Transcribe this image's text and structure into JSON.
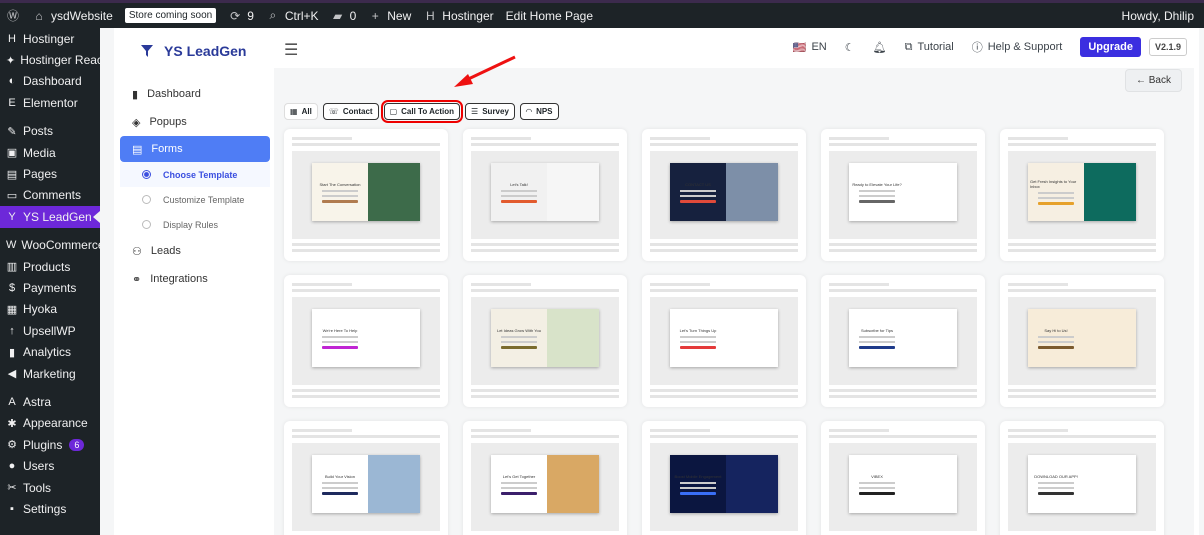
{
  "adminbar": {
    "site": "ysdWebsite",
    "store_badge": "Store coming soon",
    "updates": "9",
    "search": "Ctrl+K",
    "comments": "0",
    "new": "New",
    "hostinger": "Hostinger",
    "edit_home": "Edit Home Page",
    "howdy": "Howdy, Dhilip"
  },
  "wpmenu": [
    {
      "label": "Hostinger",
      "icon": "H"
    },
    {
      "label": "Hostinger Reach",
      "icon": "✦"
    },
    {
      "label": "Dashboard",
      "icon": "◐"
    },
    {
      "label": "Elementor",
      "icon": "E"
    },
    {
      "label": "Posts",
      "icon": "✎"
    },
    {
      "label": "Media",
      "icon": "▣"
    },
    {
      "label": "Pages",
      "icon": "▤"
    },
    {
      "label": "Comments",
      "icon": "▭"
    },
    {
      "label": "YS LeadGen",
      "icon": "Y"
    },
    {
      "label": "WooCommerce",
      "icon": "W"
    },
    {
      "label": "Products",
      "icon": "▥"
    },
    {
      "label": "Payments",
      "icon": "$"
    },
    {
      "label": "Hyoka",
      "icon": "▦"
    },
    {
      "label": "UpsellWP",
      "icon": "↑"
    },
    {
      "label": "Analytics",
      "icon": "▮"
    },
    {
      "label": "Marketing",
      "icon": "◀"
    },
    {
      "label": "Astra",
      "icon": "A"
    },
    {
      "label": "Appearance",
      "icon": "✱"
    },
    {
      "label": "Plugins",
      "icon": "⚙",
      "count": "6"
    },
    {
      "label": "Users",
      "icon": "●"
    },
    {
      "label": "Tools",
      "icon": "✂"
    },
    {
      "label": "Settings",
      "icon": "▪"
    }
  ],
  "plugin": {
    "name": "YS LeadGen",
    "lang": "EN",
    "tutorial": "Tutorial",
    "help": "Help & Support",
    "upgrade": "Upgrade",
    "version": "V2.1.9",
    "back": "Back"
  },
  "pnav": {
    "dashboard": "Dashboard",
    "popups": "Popups",
    "forms": "Forms",
    "choose": "Choose Template",
    "customize": "Customize Template",
    "display": "Display Rules",
    "leads": "Leads",
    "integrations": "Integrations"
  },
  "filters": [
    "All",
    "Contact",
    "Call To Action",
    "Survey",
    "NPS"
  ],
  "templates": [
    {
      "title": "Start The Conversation",
      "left": "#f8f4ea",
      "right": "#3d6b4a",
      "btn": "#b07b4f"
    },
    {
      "title": "Let's Talk!",
      "left": "#f1f1f1",
      "right": "#f6f6f6",
      "btn": "#e25b2e"
    },
    {
      "title": "CONTACT US",
      "left": "#16213e",
      "right": "#7d8fa8",
      "btn": "#e04a3a"
    },
    {
      "title": "Ready to Elevate Your Life?",
      "left": "#ffffff",
      "right": "#ffffff",
      "btn": "#666666"
    },
    {
      "title": "Get Fresh Insights to Your Inbox",
      "left": "#f6efe2",
      "right": "#0d6b5e",
      "btn": "#e6a12b"
    },
    {
      "title": "We're Here To Help",
      "left": "#ffffff",
      "right": "#ffffff",
      "btn": "#c026d3"
    },
    {
      "title": "Let Ideas Grow With You",
      "left": "#f3efe4",
      "right": "#d8e3c9",
      "btn": "#7a6b2e"
    },
    {
      "title": "Let's Turn Things Up",
      "left": "#ffffff",
      "right": "#ffffff",
      "btn": "#e43a3a"
    },
    {
      "title": "Subscribe for Tips",
      "left": "#ffffff",
      "right": "#ffffff",
      "btn": "#1e3a8a"
    },
    {
      "title": "Say Hi to Us!",
      "left": "#f7ecd9",
      "right": "#f7ecd9",
      "btn": "#7b5a2e"
    },
    {
      "title": "Build Your Vision",
      "left": "#ffffff",
      "right": "#9bb7d4",
      "btn": "#1e2a5e"
    },
    {
      "title": "Let's Get Together",
      "left": "#ffffff",
      "right": "#d9a864",
      "btn": "#3b1f6b"
    },
    {
      "title": "Boost Mobile Engagement",
      "left": "#0b1640",
      "right": "#15245f",
      "btn": "#3a6ff7"
    },
    {
      "title": "VIBEX",
      "left": "#ffffff",
      "right": "#ffffff",
      "btn": "#222222"
    },
    {
      "title": "DOWNLOAD OUR APP!",
      "left": "#ffffff",
      "right": "#ffffff",
      "btn": "#333333"
    }
  ]
}
